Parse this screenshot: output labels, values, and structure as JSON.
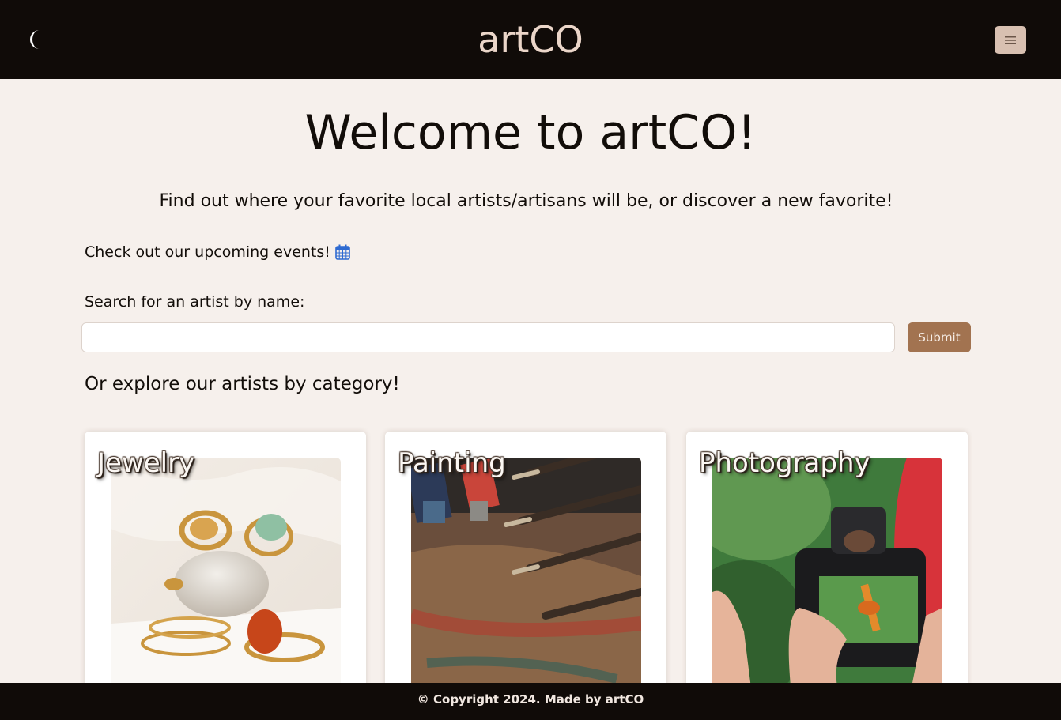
{
  "navbar": {
    "brand": "artCO",
    "theme_toggle_icon": "moon-icon",
    "menu_icon": "hamburger-icon"
  },
  "hero": {
    "title": "Welcome to artCO!",
    "subtitle": "Find out where your favorite local artists/artisans will be, or discover a new favorite!"
  },
  "events": {
    "link_text": "Check out our upcoming events!",
    "icon": "calendar-icon"
  },
  "search": {
    "label": "Search for an artist by name:",
    "value": "",
    "placeholder": "",
    "submit_label": "Submit"
  },
  "categories": {
    "heading": "Or explore our artists by category!",
    "items": [
      {
        "label": "Jewelry",
        "image": "jewelry-rings-photo"
      },
      {
        "label": "Painting",
        "image": "paint-brushes-photo"
      },
      {
        "label": "Photography",
        "image": "camera-photo"
      }
    ]
  },
  "footer": {
    "text": "© Copyright 2024. Made by artCO"
  },
  "colors": {
    "nav_bg": "#100b08",
    "page_bg": "#f6f0ec",
    "brand_text": "#ebd6c9",
    "submit_bg": "#a27350",
    "menu_button_bg": "#d8c0b1"
  }
}
